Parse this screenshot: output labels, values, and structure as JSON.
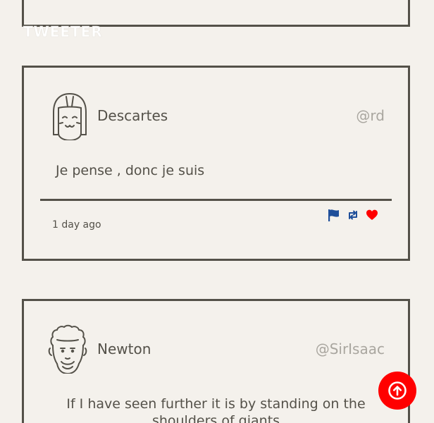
{
  "app": {
    "brand": "TWEETER"
  },
  "tweets": [
    {
      "avatar_icon": "girl-face-avatar-icon",
      "name": "Descartes",
      "handle": "@rd",
      "content": "Je pense , donc je suis",
      "timestamp": "1 day ago",
      "actions": [
        "flag-icon",
        "retweet-icon",
        "heart-icon"
      ]
    },
    {
      "avatar_icon": "curly-hair-man-avatar-icon",
      "name": "Newton",
      "handle": "@SirIsaac",
      "content": "If I have seen further it is by standing on the shoulders of giants"
    }
  ],
  "scroll_top": {
    "icon": "arrow-up-circle-icon"
  },
  "colors": {
    "background": "#f4f1ec",
    "border": "#545149",
    "handle": "#a9a69f",
    "flag": "#1f4f9a",
    "retweet": "#1f4f9a",
    "heart": "#ff0000",
    "scroll_button": "#ff0000"
  }
}
